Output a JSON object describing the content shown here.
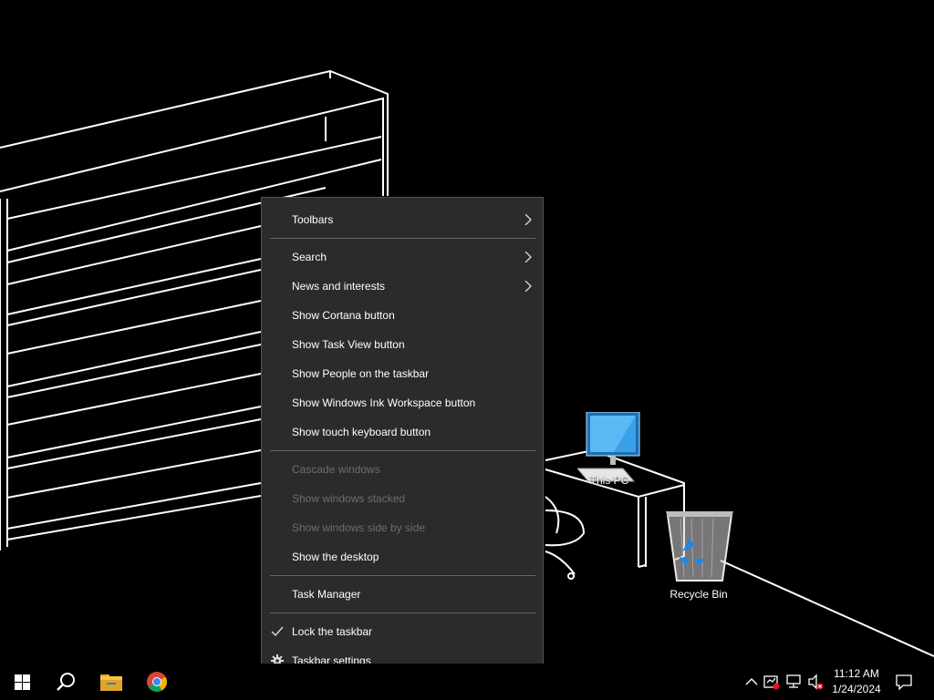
{
  "desktop": {
    "icons": [
      {
        "label": "This PC"
      },
      {
        "label": "Recycle Bin"
      }
    ]
  },
  "context_menu": {
    "items": [
      {
        "label": "Toolbars",
        "submenu": true
      },
      {
        "label": "Search",
        "submenu": true
      },
      {
        "label": "News and interests",
        "submenu": true
      },
      {
        "label": "Show Cortana button"
      },
      {
        "label": "Show Task View button"
      },
      {
        "label": "Show People on the taskbar"
      },
      {
        "label": "Show Windows Ink Workspace button"
      },
      {
        "label": "Show touch keyboard button"
      },
      {
        "label": "Cascade windows",
        "disabled": true
      },
      {
        "label": "Show windows stacked",
        "disabled": true
      },
      {
        "label": "Show windows side by side",
        "disabled": true
      },
      {
        "label": "Show the desktop"
      },
      {
        "label": "Task Manager"
      },
      {
        "label": "Lock the taskbar",
        "checked": true
      },
      {
        "label": "Taskbar settings",
        "icon": "gear-icon"
      }
    ]
  },
  "taskbar": {
    "pinned": [
      {
        "name": "start-button",
        "icon": "windows-logo-icon"
      },
      {
        "name": "search-button",
        "icon": "search-icon"
      },
      {
        "name": "file-explorer-button",
        "icon": "folder-icon"
      },
      {
        "name": "chrome-button",
        "icon": "chrome-icon"
      }
    ],
    "tray_icons": [
      "chevron-up-icon",
      "defender-icon",
      "network-icon",
      "volume-muted-icon"
    ],
    "clock": {
      "time": "11:12 AM",
      "date": "1/24/2024"
    },
    "notification_icon": "notification-icon"
  },
  "colors": {
    "menu_bg": "#2b2b2b",
    "menu_disabled": "#6d6d6d",
    "monitor_blue": "#3aa0e8",
    "recycle_blue": "#1e88e5"
  }
}
